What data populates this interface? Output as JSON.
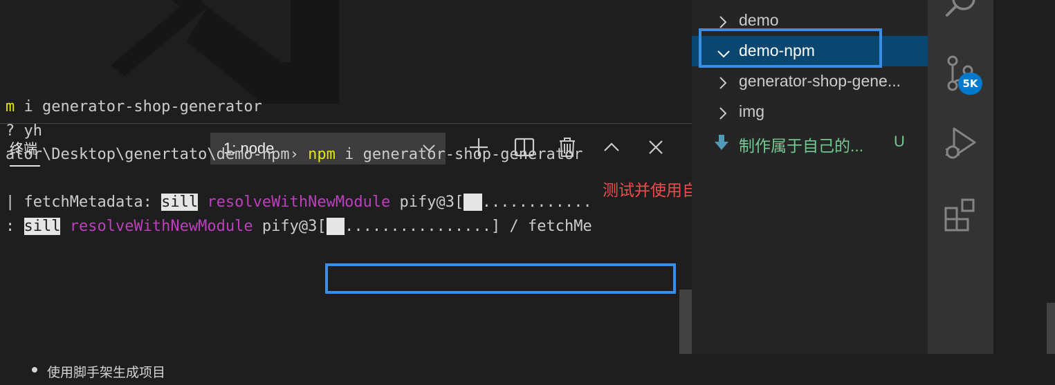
{
  "panel": {
    "tab_label": "终端",
    "terminal_select_value": "1: node"
  },
  "terminal": {
    "line1_prompt": "m",
    "line1_cmd": " i generator-shop-generator",
    "line2": "? yh",
    "line3_path": "ator\\Desktop\\genertato\\demo-npm",
    "line3_sep": "›",
    "line3_npm": " npm",
    "line3_cmd": " i generator-shop-generator",
    "line4_a": "| fetchMetadata: ",
    "line4_sill": "sill",
    "line4_mod": " resolveWithNewModule",
    "line4_b": " pify@3[",
    "line4_dots": "............",
    "line5_a": ": ",
    "line5_sill": "sill",
    "line5_mod": " resolveWithNewModule",
    "line5_b": " pify@3[",
    "line5_dots": "................] / fetchMe"
  },
  "annotation": "测试并使用自己的脚手架",
  "explorer": {
    "items": [
      {
        "label": "demo",
        "state": "collapsed"
      },
      {
        "label": "demo-npm",
        "state": "expanded"
      },
      {
        "label": "generator-shop-gene...",
        "state": "collapsed"
      },
      {
        "label": "img",
        "state": "collapsed"
      },
      {
        "label": "制作属于自己的...",
        "status": "U"
      }
    ]
  },
  "activity": {
    "source_control_badge": "5K",
    "icons": [
      "search-icon",
      "source-control-icon",
      "run-debug-icon",
      "extensions-icon"
    ]
  },
  "bottom_line": "使用脚手架生成项目",
  "colors": {
    "accent_highlight": "#3b8ee6",
    "annotation_red": "#f14c4c",
    "git_untracked": "#73c991",
    "badge_blue": "#007acc",
    "terminal_yellow": "#e5e510",
    "terminal_magenta": "#bc3fbc"
  }
}
